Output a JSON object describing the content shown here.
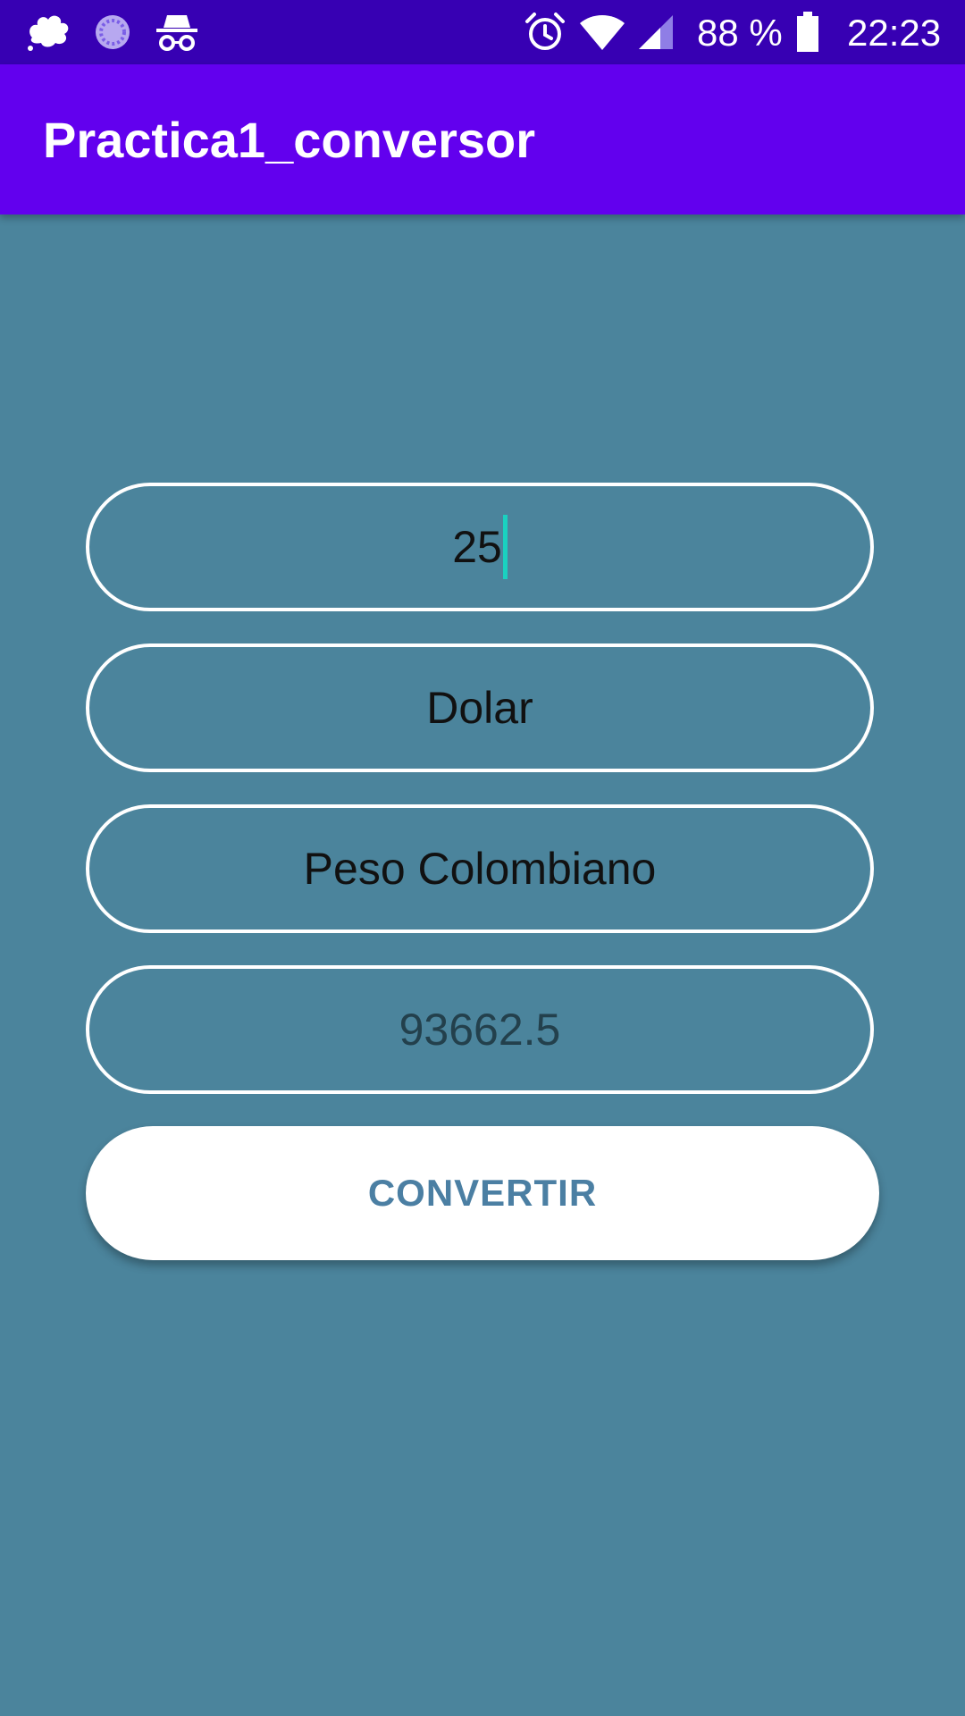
{
  "status_bar": {
    "battery_text": "88 %",
    "time": "22:23",
    "left_icons": [
      "app-notification-icon",
      "sync-icon",
      "incognito-icon"
    ],
    "right_icons": [
      "alarm-icon",
      "wifi-icon",
      "signal-icon",
      "battery-icon"
    ]
  },
  "app_bar": {
    "title": "Practica1_conversor"
  },
  "form": {
    "amount_value": "25",
    "from_currency": "Dolar",
    "to_currency": "Peso Colombiano",
    "result_value": "93662.5",
    "convert_label": "CONVERTIR"
  },
  "colors": {
    "status_bar": "#3700b3",
    "app_bar": "#6200ee",
    "background": "#4b849c",
    "button_text": "#4b7fa3",
    "cursor": "#1ad1c0"
  }
}
